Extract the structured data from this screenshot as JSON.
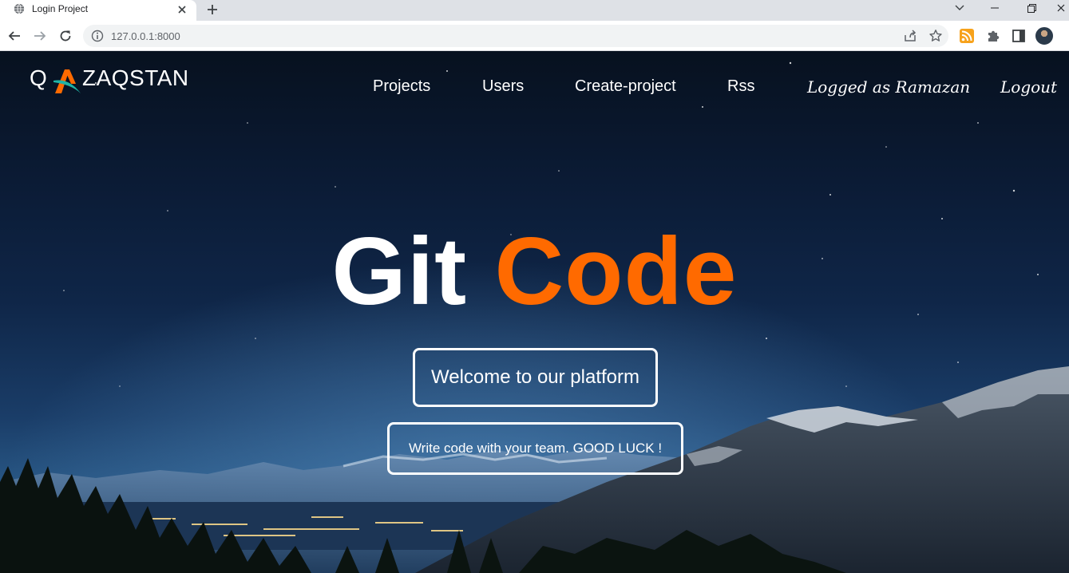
{
  "browser": {
    "tab": {
      "title": "Login Project"
    },
    "address_bar": {
      "url": "127.0.0.1:8000"
    }
  },
  "site": {
    "logo": {
      "first_letter": "Q",
      "rest": "ZAQSTAN",
      "accent_color": "#ff6a00",
      "accent2_color": "#1fb3a6"
    },
    "nav": {
      "projects": "Projects",
      "users": "Users",
      "create_project": "Create-project",
      "rss": "Rss",
      "logged_as": "Logged as Ramazan",
      "logout": "Logout"
    },
    "hero": {
      "title_part1": "Git",
      "title_part2": "Code",
      "title_part2_color": "#ff6a00",
      "welcome": "Welcome to our platform",
      "tagline": "Write code with your team. GOOD LUCK !"
    }
  },
  "icons": {
    "tab_favicon": "globe-icon",
    "close": "close-icon",
    "new_tab": "plus-icon",
    "back": "arrow-left-icon",
    "forward": "arrow-right-icon",
    "reload": "reload-icon",
    "site_info": "info-icon",
    "share": "share-icon",
    "bookmark": "star-icon",
    "rss_ext": "rss-icon",
    "extensions": "puzzle-icon",
    "side_panel": "side-panel-icon"
  }
}
